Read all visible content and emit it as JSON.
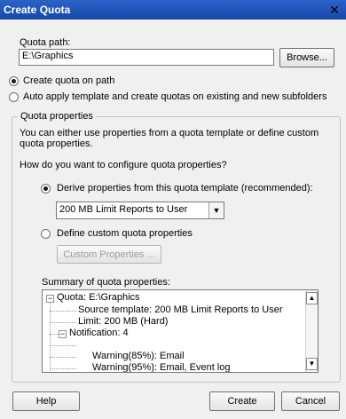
{
  "window": {
    "title": "Create Quota"
  },
  "quota_path": {
    "label": "Quota path:",
    "value": "E:\\Graphics",
    "browse_label": "Browse..."
  },
  "modes": [
    {
      "label": "Create quota on path",
      "selected": true
    },
    {
      "label": "Auto apply template and create quotas on existing and new subfolders",
      "selected": false
    }
  ],
  "properties": {
    "legend": "Quota properties",
    "description": "You can either use properties from a quota template or define custom quota properties.",
    "question": "How do you want to configure quota properties?",
    "derive_label": "Derive properties from this quota template (recommended):",
    "template_selected": "200 MB Limit Reports to User",
    "custom_label": "Define custom quota properties",
    "custom_button": "Custom Properties ...",
    "summary_label": "Summary of quota properties:",
    "summary": {
      "root": "Quota: E:\\Graphics",
      "source": "Source template: 200 MB Limit Reports to User",
      "limit": "Limit: 200 MB (Hard)",
      "notification": "Notification: 4",
      "warn85": "Warning(85%): Email",
      "warn95": "Warning(95%): Email, Event log"
    }
  },
  "buttons": {
    "help": "Help",
    "create": "Create",
    "cancel": "Cancel"
  }
}
